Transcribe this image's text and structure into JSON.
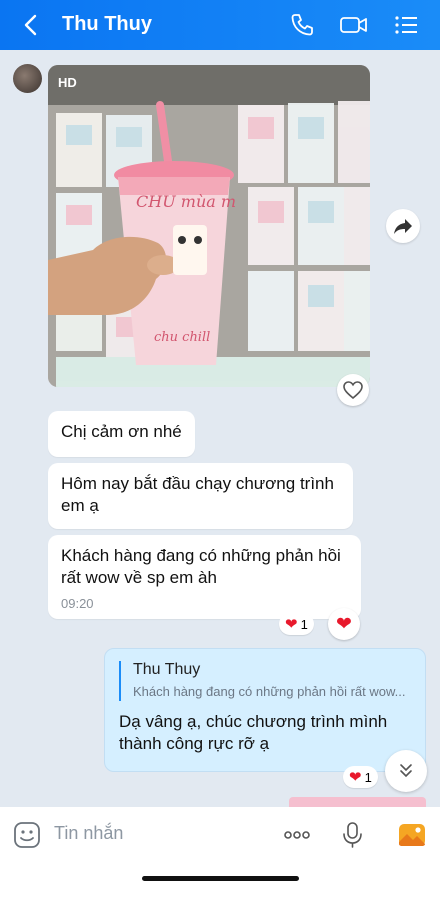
{
  "header": {
    "title": "Thu Thuy",
    "icons": [
      "back-icon",
      "phone-icon",
      "video-call-icon",
      "menu-list-icon"
    ]
  },
  "photo_message": {
    "badge": "HD",
    "product_text": [
      "CHU mùa m",
      "chu chill"
    ]
  },
  "messages": [
    {
      "text": "Chị cảm ơn nhé"
    },
    {
      "text": "Hôm nay bắt đầu chạy chương trình em ạ"
    },
    {
      "text": "Khách hàng đang có những phản hồi rất wow về sp em àh",
      "time": "09:20",
      "reaction_count": "1"
    }
  ],
  "my_message": {
    "quote_name": "Thu Thuy",
    "quote_text": "Khách hàng đang có những phản hồi rất wow...",
    "text": "Dạ vâng ạ, chúc chương trình mình thành công rực rỡ ạ",
    "reaction_count": "1"
  },
  "input_bar": {
    "placeholder": "Tin nhắn",
    "icons": [
      "sticker-icon",
      "more-icon",
      "voice-icon",
      "image-icon"
    ]
  },
  "colors": {
    "header": "#0a75f2",
    "my_bubble": "#d5efff",
    "background": "#e2e9f1",
    "heart": "#e8192c"
  }
}
